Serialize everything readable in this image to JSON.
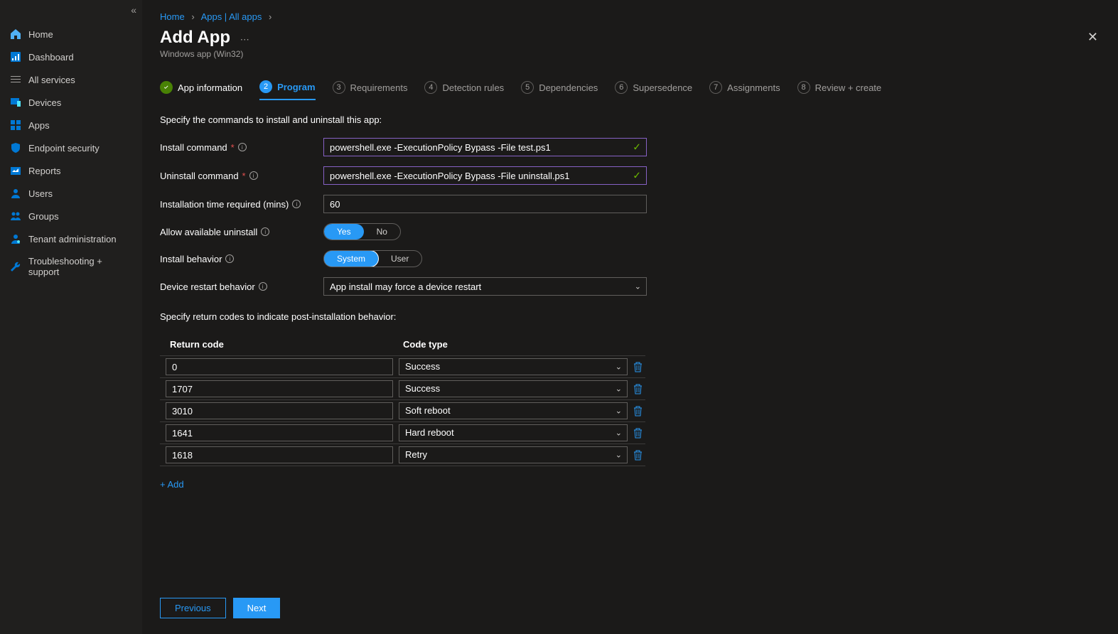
{
  "sidebar": {
    "items": [
      {
        "label": "Home",
        "icon": "home-icon",
        "color": "#2899f5"
      },
      {
        "label": "Dashboard",
        "icon": "dashboard-icon",
        "color": "#50e6ff"
      },
      {
        "label": "All services",
        "icon": "list-icon",
        "color": "#a19f9d"
      },
      {
        "label": "Devices",
        "icon": "devices-icon",
        "color": "#2899f5"
      },
      {
        "label": "Apps",
        "icon": "apps-icon",
        "color": "#2899f5"
      },
      {
        "label": "Endpoint security",
        "icon": "shield-icon",
        "color": "#2899f5"
      },
      {
        "label": "Reports",
        "icon": "reports-icon",
        "color": "#2899f5"
      },
      {
        "label": "Users",
        "icon": "users-icon",
        "color": "#2899f5"
      },
      {
        "label": "Groups",
        "icon": "groups-icon",
        "color": "#2899f5"
      },
      {
        "label": "Tenant administration",
        "icon": "admin-icon",
        "color": "#2899f5"
      },
      {
        "label": "Troubleshooting + support",
        "icon": "wrench-icon",
        "color": "#2899f5"
      }
    ]
  },
  "breadcrumb": {
    "items": [
      "Home",
      "Apps | All apps"
    ]
  },
  "header": {
    "title": "Add App",
    "subtitle": "Windows app (Win32)"
  },
  "tabs": [
    {
      "label": "App information",
      "state": "done"
    },
    {
      "label": "Program",
      "state": "active",
      "num": "2"
    },
    {
      "label": "Requirements",
      "num": "3"
    },
    {
      "label": "Detection rules",
      "num": "4"
    },
    {
      "label": "Dependencies",
      "num": "5"
    },
    {
      "label": "Supersedence",
      "num": "6"
    },
    {
      "label": "Assignments",
      "num": "7"
    },
    {
      "label": "Review + create",
      "num": "8"
    }
  ],
  "form": {
    "section1_text": "Specify the commands to install and uninstall this app:",
    "install_cmd_label": "Install command",
    "install_cmd_value": "powershell.exe -ExecutionPolicy Bypass -File test.ps1",
    "uninstall_cmd_label": "Uninstall command",
    "uninstall_cmd_value": "powershell.exe -ExecutionPolicy Bypass -File uninstall.ps1",
    "install_time_label": "Installation time required (mins)",
    "install_time_value": "60",
    "allow_uninstall_label": "Allow available uninstall",
    "allow_uninstall_yes": "Yes",
    "allow_uninstall_no": "No",
    "install_behavior_label": "Install behavior",
    "install_behavior_system": "System",
    "install_behavior_user": "User",
    "restart_behavior_label": "Device restart behavior",
    "restart_behavior_value": "App install may force a device restart",
    "section2_text": "Specify return codes to indicate post-installation behavior:",
    "table_col1": "Return code",
    "table_col2": "Code type",
    "return_codes": [
      {
        "code": "0",
        "type": "Success"
      },
      {
        "code": "1707",
        "type": "Success"
      },
      {
        "code": "3010",
        "type": "Soft reboot"
      },
      {
        "code": "1641",
        "type": "Hard reboot"
      },
      {
        "code": "1618",
        "type": "Retry"
      }
    ],
    "add_label": "+ Add"
  },
  "footer": {
    "previous": "Previous",
    "next": "Next"
  }
}
